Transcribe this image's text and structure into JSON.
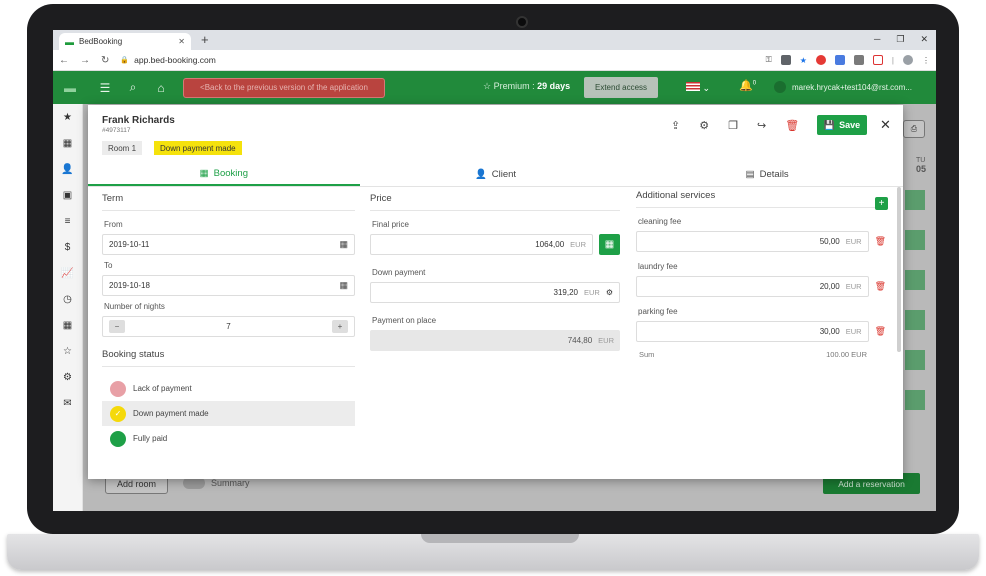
{
  "browser": {
    "tab_title": "BedBooking",
    "url": "app.bed-booking.com"
  },
  "header": {
    "back_label": "<Back to the previous version of the application",
    "premium_label": "Premium : ",
    "premium_days": "29 days",
    "extend_label": "Extend access",
    "notification_count": "0",
    "user_email": "marek.hrycak+test104@rst.com..."
  },
  "background": {
    "add_room_label": "Add room",
    "summary_label": "Summary",
    "add_reservation_label": "Add a reservation",
    "day_abbr": "TU",
    "day_num": "05"
  },
  "modal": {
    "guest_name": "Frank Richards",
    "booking_id": "#4973117",
    "room_badge": "Room 1",
    "status_badge": "Down payment made",
    "save_label": "Save",
    "tabs": [
      {
        "label": "Booking"
      },
      {
        "label": "Client"
      },
      {
        "label": "Details"
      }
    ],
    "term": {
      "title": "Term",
      "from_label": "From",
      "from_value": "2019-10-11",
      "to_label": "To",
      "to_value": "2019-10-18",
      "nights_label": "Number of nights",
      "nights_value": "7"
    },
    "booking_status": {
      "title": "Booking status",
      "options": [
        {
          "label": "Lack of payment",
          "color": "#e8a0a6"
        },
        {
          "label": "Down payment made",
          "color": "#f5d90a"
        },
        {
          "label": "Fully paid",
          "color": "#1ea047"
        }
      ]
    },
    "price": {
      "title": "Price",
      "final_label": "Final price",
      "final_value": "1064,00",
      "currency": "EUR",
      "down_label": "Down payment",
      "down_value": "319,20",
      "onplace_label": "Payment on place",
      "onplace_value": "744,80"
    },
    "services": {
      "title": "Additional services",
      "items": [
        {
          "label": "cleaning fee",
          "value": "50,00"
        },
        {
          "label": "laundry fee",
          "value": "20,00"
        },
        {
          "label": "parking fee",
          "value": "30,00"
        }
      ],
      "sum_label": "Sum",
      "sum_value": "100.00 EUR"
    }
  },
  "colors": {
    "brand_green": "#218a3b",
    "accent_green": "#1ea047",
    "status_yellow": "#f5e20c"
  }
}
